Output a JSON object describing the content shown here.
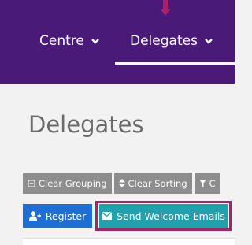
{
  "nav": {
    "items": [
      {
        "label": "Centre"
      },
      {
        "label": "Delegates"
      }
    ]
  },
  "page": {
    "title": "Delegates"
  },
  "toolbar": {
    "clear_grouping": "Clear Grouping",
    "clear_sorting": "Clear Sorting",
    "filter_partial": "C"
  },
  "actions": {
    "register": "Register",
    "send_welcome": "Send Welcome Emails"
  },
  "colors": {
    "nav_bg": "#4a1a78",
    "highlight": "#ab1f6b",
    "register_blue": "#1d6fd6",
    "welcome_teal": "#21a0ad",
    "toolbar_grey": "#8d8d8d"
  }
}
